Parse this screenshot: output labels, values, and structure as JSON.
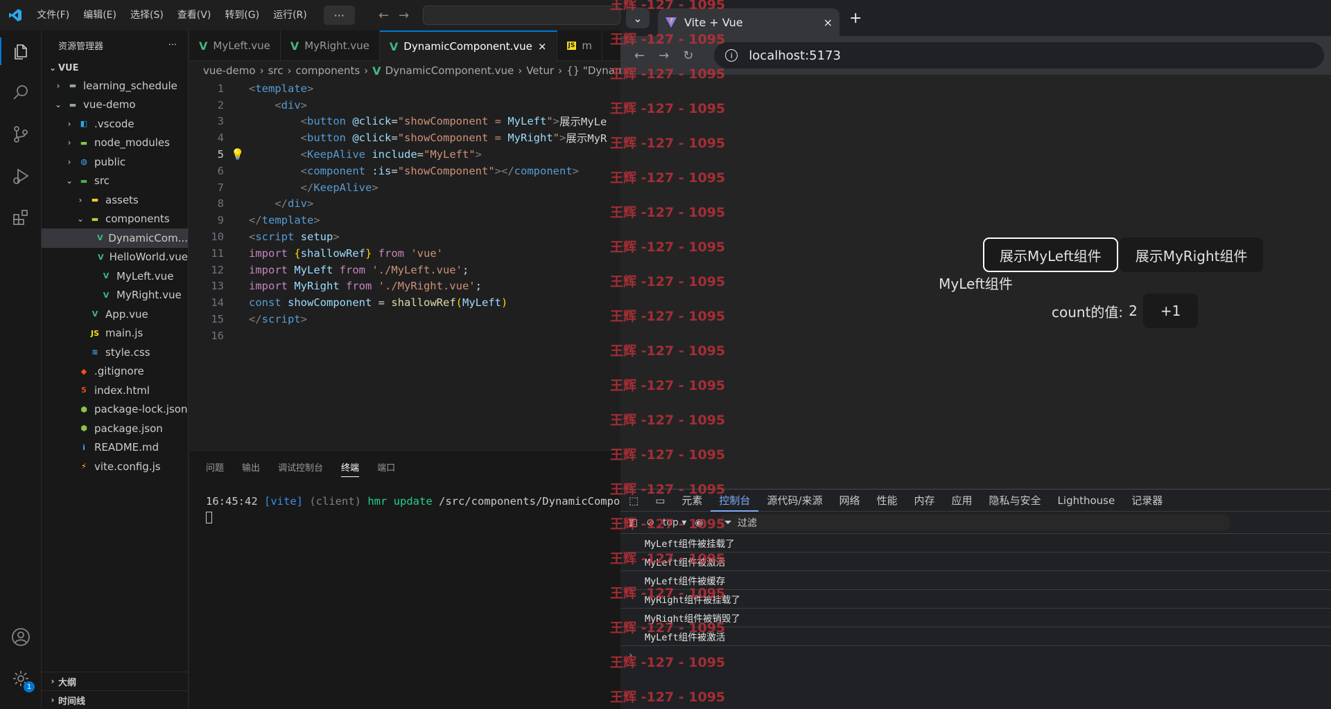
{
  "vscode": {
    "menu": [
      "文件(F)",
      "编辑(E)",
      "选择(S)",
      "查看(V)",
      "转到(G)",
      "运行(R)"
    ],
    "more": "···",
    "explorer_title": "资源管理器",
    "explorer_more": "···",
    "workspace": "VUE",
    "tree": [
      {
        "label": "learning_schedule",
        "icon": "folder",
        "indent": 1,
        "chev": "›"
      },
      {
        "label": "vue-demo",
        "icon": "folder-open",
        "indent": 1,
        "chev": "⌄"
      },
      {
        "label": ".vscode",
        "icon": "vscode-folder",
        "indent": 2,
        "chev": "›"
      },
      {
        "label": "node_modules",
        "icon": "node-folder",
        "indent": 2,
        "chev": "›"
      },
      {
        "label": "public",
        "icon": "public-folder",
        "indent": 2,
        "chev": "›"
      },
      {
        "label": "src",
        "icon": "src-folder",
        "indent": 2,
        "chev": "⌄"
      },
      {
        "label": "assets",
        "icon": "assets-folder",
        "indent": 3,
        "chev": "›"
      },
      {
        "label": "components",
        "icon": "components-folder",
        "indent": 3,
        "chev": "⌄"
      },
      {
        "label": "DynamicCom...",
        "icon": "vue",
        "indent": 4,
        "chev": ""
      },
      {
        "label": "HelloWorld.vue",
        "icon": "vue",
        "indent": 4,
        "chev": ""
      },
      {
        "label": "MyLeft.vue",
        "icon": "vue",
        "indent": 4,
        "chev": ""
      },
      {
        "label": "MyRight.vue",
        "icon": "vue",
        "indent": 4,
        "chev": ""
      },
      {
        "label": "App.vue",
        "icon": "vue",
        "indent": 3,
        "chev": ""
      },
      {
        "label": "main.js",
        "icon": "js",
        "indent": 3,
        "chev": ""
      },
      {
        "label": "style.css",
        "icon": "css",
        "indent": 3,
        "chev": ""
      },
      {
        "label": ".gitignore",
        "icon": "git",
        "indent": 2,
        "chev": ""
      },
      {
        "label": "index.html",
        "icon": "html",
        "indent": 2,
        "chev": ""
      },
      {
        "label": "package-lock.json",
        "icon": "npm",
        "indent": 2,
        "chev": ""
      },
      {
        "label": "package.json",
        "icon": "npm",
        "indent": 2,
        "chev": ""
      },
      {
        "label": "README.md",
        "icon": "info",
        "indent": 2,
        "chev": ""
      },
      {
        "label": "vite.config.js",
        "icon": "vite",
        "indent": 2,
        "chev": ""
      }
    ],
    "outline": "大纲",
    "timeline": "时间线",
    "tabs": [
      {
        "label": "MyLeft.vue",
        "active": false
      },
      {
        "label": "MyRight.vue",
        "active": false
      },
      {
        "label": "DynamicComponent.vue",
        "active": true
      },
      {
        "label": "m",
        "active": false
      }
    ],
    "tab_close": "×",
    "breadcrumb": [
      "vue-demo",
      "src",
      "components",
      "DynamicComponent.vue",
      "Vetur",
      "{} \"Dynam"
    ],
    "code_lines": [
      [
        [
          "t-punc",
          "<"
        ],
        [
          "t-tag",
          "template"
        ],
        [
          "t-punc",
          ">"
        ]
      ],
      [
        [
          "t-txt",
          "    "
        ],
        [
          "t-punc",
          "<"
        ],
        [
          "t-tag",
          "div"
        ],
        [
          "t-punc",
          ">"
        ]
      ],
      [
        [
          "t-txt",
          "        "
        ],
        [
          "t-punc",
          "<"
        ],
        [
          "t-tag",
          "button"
        ],
        [
          "t-txt",
          " "
        ],
        [
          "t-attr",
          "@click"
        ],
        [
          "t-txt",
          "="
        ],
        [
          "t-str",
          "\"showComponent = "
        ],
        [
          "t-var",
          "MyLeft"
        ],
        [
          "t-str",
          "\""
        ],
        [
          "t-punc",
          ">"
        ],
        [
          "t-txt",
          "展示MyLe"
        ]
      ],
      [
        [
          "t-txt",
          "        "
        ],
        [
          "t-punc",
          "<"
        ],
        [
          "t-tag",
          "button"
        ],
        [
          "t-txt",
          " "
        ],
        [
          "t-attr",
          "@click"
        ],
        [
          "t-txt",
          "="
        ],
        [
          "t-str",
          "\"showComponent = "
        ],
        [
          "t-var",
          "MyRight"
        ],
        [
          "t-str",
          "\""
        ],
        [
          "t-punc",
          ">"
        ],
        [
          "t-txt",
          "展示MyR"
        ]
      ],
      [
        [
          "t-txt",
          "        "
        ],
        [
          "t-punc",
          "<"
        ],
        [
          "t-tag",
          "KeepAlive"
        ],
        [
          "t-txt",
          " "
        ],
        [
          "t-attr",
          "include"
        ],
        [
          "t-txt",
          "="
        ],
        [
          "t-str",
          "\"MyLeft\""
        ],
        [
          "t-punc",
          ">"
        ]
      ],
      [
        [
          "t-txt",
          "        "
        ],
        [
          "t-punc",
          "<"
        ],
        [
          "t-tag",
          "component"
        ],
        [
          "t-txt",
          " "
        ],
        [
          "t-attr",
          ":is"
        ],
        [
          "t-txt",
          "="
        ],
        [
          "t-str",
          "\"showComponent\""
        ],
        [
          "t-punc",
          "></"
        ],
        [
          "t-tag",
          "component"
        ],
        [
          "t-punc",
          ">"
        ]
      ],
      [
        [
          "t-txt",
          "        "
        ],
        [
          "t-punc",
          "</"
        ],
        [
          "t-tag",
          "KeepAlive"
        ],
        [
          "t-punc",
          ">"
        ]
      ],
      [
        [
          "t-txt",
          "    "
        ],
        [
          "t-punc",
          "</"
        ],
        [
          "t-tag",
          "div"
        ],
        [
          "t-punc",
          ">"
        ]
      ],
      [
        [
          "t-punc",
          "</"
        ],
        [
          "t-tag",
          "template"
        ],
        [
          "t-punc",
          ">"
        ]
      ],
      [
        [
          "t-punc",
          "<"
        ],
        [
          "t-tag",
          "script"
        ],
        [
          "t-txt",
          " "
        ],
        [
          "t-attr",
          "setup"
        ],
        [
          "t-punc",
          ">"
        ]
      ],
      [
        [
          "t-kw",
          "import "
        ],
        [
          "t-br",
          "{"
        ],
        [
          "t-var",
          "shallowRef"
        ],
        [
          "t-br",
          "}"
        ],
        [
          "t-kw",
          " from "
        ],
        [
          "t-str",
          "'vue'"
        ]
      ],
      [
        [
          "t-kw",
          "import "
        ],
        [
          "t-var",
          "MyLeft"
        ],
        [
          "t-kw",
          " from "
        ],
        [
          "t-str",
          "'./MyLeft.vue'"
        ],
        [
          "t-txt",
          ";"
        ]
      ],
      [
        [
          "t-kw",
          "import "
        ],
        [
          "t-var",
          "MyRight"
        ],
        [
          "t-kw",
          " from "
        ],
        [
          "t-str",
          "'./MyRight.vue'"
        ],
        [
          "t-txt",
          ";"
        ]
      ],
      [
        [
          "t-tag",
          "const "
        ],
        [
          "t-var",
          "showComponent"
        ],
        [
          "t-txt",
          " = "
        ],
        [
          "t-fn",
          "shallowRef"
        ],
        [
          "t-br",
          "("
        ],
        [
          "t-var",
          "MyLeft"
        ],
        [
          "t-br",
          ")"
        ]
      ],
      [
        [
          "t-punc",
          "</"
        ],
        [
          "t-tag",
          "script"
        ],
        [
          "t-punc",
          ">"
        ]
      ],
      []
    ],
    "current_line": 5,
    "panel_tabs": [
      "问题",
      "输出",
      "调试控制台",
      "终端",
      "端口"
    ],
    "panel_active": "终端",
    "terminal": [
      [
        [
          "#cccccc",
          "16:45:42 "
        ],
        [
          "#3b8eea",
          "[vite]"
        ],
        [
          "#808080",
          " (client) "
        ],
        [
          "#23d18b",
          "hmr update "
        ],
        [
          "#cccccc",
          "/src/components/DynamicCompone"
        ]
      ]
    ]
  },
  "browser": {
    "tab_title": "Vite + Vue",
    "tab_close": "×",
    "new_tab": "+",
    "url": "localhost:5173",
    "buttons": [
      "展示MyLeft组件",
      "展示MyRight组件"
    ],
    "component_title": "MyLeft组件",
    "count_label": "count的值:",
    "count_value": "2",
    "increment": "+1",
    "devtools_tabs": [
      "元素",
      "控制台",
      "源代码/来源",
      "网络",
      "性能",
      "内存",
      "应用",
      "隐私与安全",
      "Lighthouse",
      "记录器"
    ],
    "devtools_active": "控制台",
    "context": "top",
    "filter": "过滤",
    "console": [
      "MyLeft组件被挂载了",
      "MyLeft组件被激活",
      "MyLeft组件被缓存",
      "MyRight组件被挂载了",
      "MyRight组件被销毁了",
      "MyLeft组件被激活"
    ],
    "prompt": "›"
  },
  "watermark": {
    "text": "王辉 -127 - 1095",
    "count": 21
  },
  "colors": {
    "accent": "#0078d4",
    "vue_green": "#42b883",
    "watermark": "#c8323a"
  }
}
